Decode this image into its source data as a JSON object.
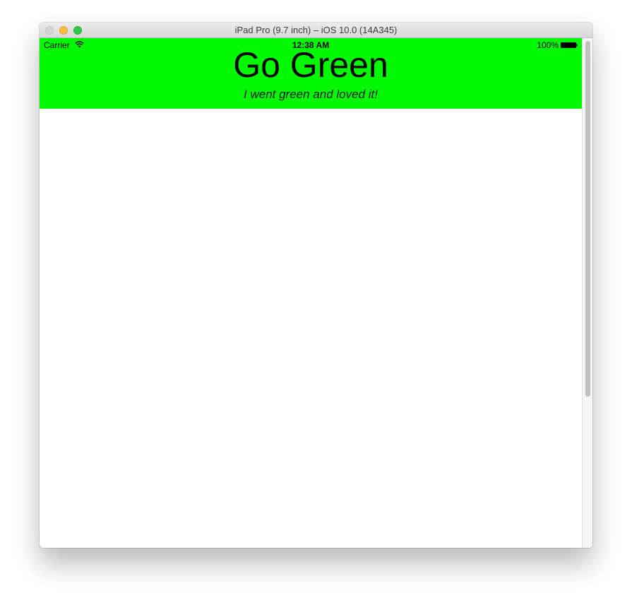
{
  "window": {
    "title": "iPad Pro (9.7 inch) – iOS 10.0 (14A345)"
  },
  "status_bar": {
    "carrier": "Carrier",
    "time": "12:38 AM",
    "battery": "100%",
    "icons": [
      "wifi-icon",
      "battery-icon"
    ]
  },
  "header": {
    "title": "Go Green",
    "subtitle": "I went green and loved it!",
    "background_color": "#00f800"
  }
}
